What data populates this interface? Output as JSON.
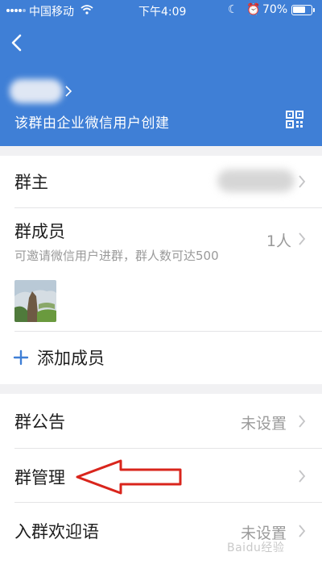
{
  "status_bar": {
    "carrier": "中国移动",
    "time": "下午4:09",
    "battery_percent": "70%",
    "battery_level": 0.7
  },
  "header": {
    "back_icon": "chevron-left-icon",
    "created_by": "该群由企业微信用户创建",
    "qr_icon": "qr-code-icon",
    "bg_color": "#3f7fd6"
  },
  "rows": {
    "owner": {
      "label": "群主"
    },
    "members": {
      "label": "群成员",
      "count": "1人",
      "hint": "可邀请微信用户进群，群人数可达500"
    },
    "add_member": {
      "label": "添加成员",
      "icon": "plus-icon"
    },
    "announcement": {
      "label": "群公告",
      "value": "未设置"
    },
    "management": {
      "label": "群管理"
    },
    "welcome": {
      "label": "入群欢迎语",
      "value": "未设置"
    }
  },
  "watermark": "Baidu经验"
}
